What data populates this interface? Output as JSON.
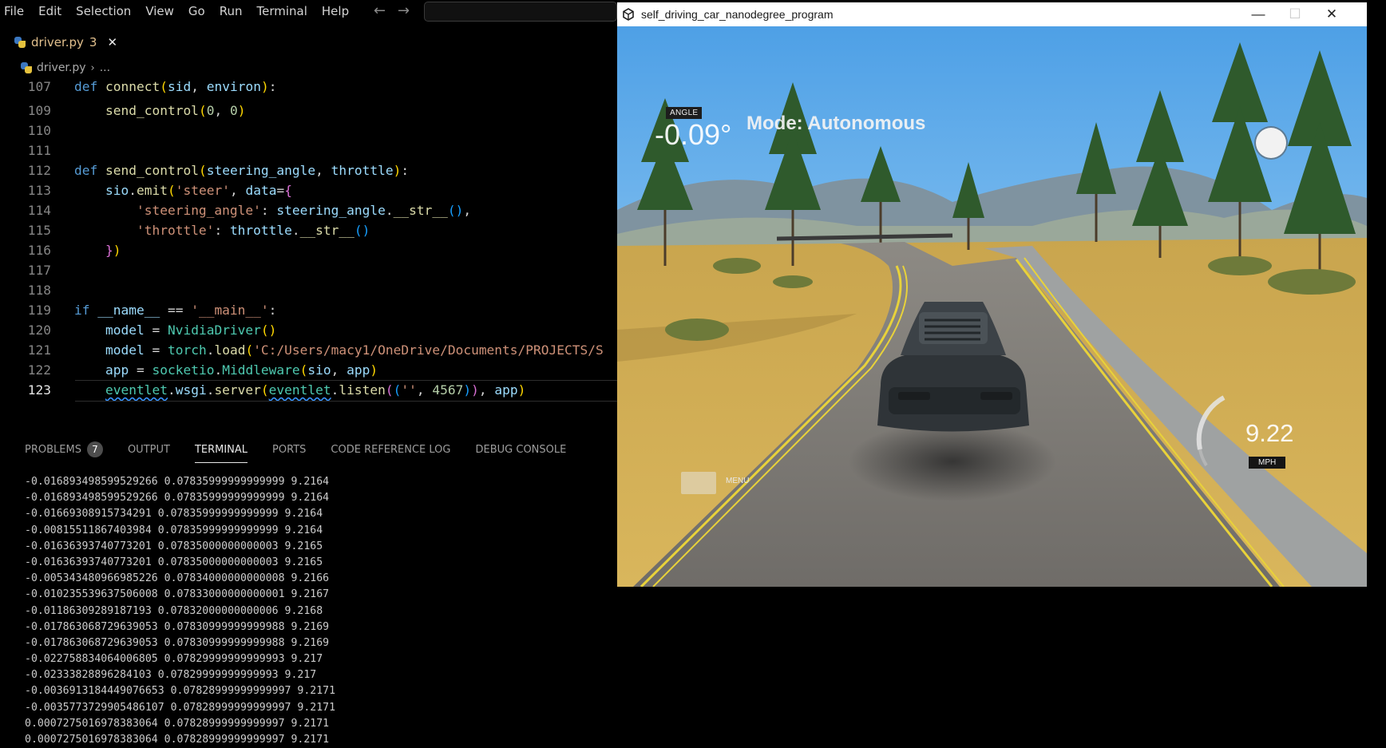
{
  "menubar": {
    "items": [
      "File",
      "Edit",
      "Selection",
      "View",
      "Go",
      "Run",
      "Terminal",
      "Help"
    ]
  },
  "editor_tab": {
    "file": "driver.py",
    "problems": "3"
  },
  "breadcrumb": {
    "file": "driver.py",
    "rest": "..."
  },
  "code": {
    "lines": [
      {
        "n": "107",
        "html": "<span class=\"kw\">def</span> <span class=\"fn\">connect</span><span class=\"br1\">(</span><span class=\"var\">sid</span>, <span class=\"var\">environ</span><span class=\"br1\">)</span>:"
      },
      {
        "n": "109",
        "html": "    <span class=\"fn\">send_control</span><span class=\"br1\">(</span><span class=\"num\">0</span>, <span class=\"num\">0</span><span class=\"br1\">)</span>"
      },
      {
        "n": "110",
        "html": ""
      },
      {
        "n": "111",
        "html": ""
      },
      {
        "n": "112",
        "html": "<span class=\"kw\">def</span> <span class=\"fn\">send_control</span><span class=\"br1\">(</span><span class=\"var\">steering_angle</span>, <span class=\"var\">throttle</span><span class=\"br1\">)</span>:"
      },
      {
        "n": "113",
        "html": "    <span class=\"var\">sio</span>.<span class=\"fn\">emit</span><span class=\"br1\">(</span><span class=\"str\">'steer'</span>, <span class=\"var\">data</span>=<span class=\"br2\">{</span>"
      },
      {
        "n": "114",
        "html": "        <span class=\"str\">'steering_angle'</span>: <span class=\"var\">steering_angle</span>.<span class=\"fn\">__str__</span><span class=\"br3\">()</span>,"
      },
      {
        "n": "115",
        "html": "        <span class=\"str\">'throttle'</span>: <span class=\"var\">throttle</span>.<span class=\"fn\">__str__</span><span class=\"br3\">()</span>"
      },
      {
        "n": "116",
        "html": "    <span class=\"br2\">}</span><span class=\"br1\">)</span>"
      },
      {
        "n": "117",
        "html": ""
      },
      {
        "n": "118",
        "html": ""
      },
      {
        "n": "119",
        "html": "<span class=\"kw\">if</span> <span class=\"var\">__name__</span> == <span class=\"str\">'__main__'</span>:"
      },
      {
        "n": "120",
        "html": "    <span class=\"var\">model</span> = <span class=\"cls\">NvidiaDriver</span><span class=\"br1\">()</span>"
      },
      {
        "n": "121",
        "html": "    <span class=\"var\">model</span> = <span class=\"cls\">torch</span>.<span class=\"fn\">load</span><span class=\"br1\">(</span><span class=\"str\">'C:/Users/macy1/OneDrive/Documents/PROJECTS/S</span>"
      },
      {
        "n": "122",
        "html": "    <span class=\"var\">app</span> = <span class=\"cls\">socketio</span>.<span class=\"cls\">Middleware</span><span class=\"br1\">(</span><span class=\"var\">sio</span>, <span class=\"var\">app</span><span class=\"br1\">)</span>"
      },
      {
        "n": "123",
        "html": "    <span class=\"cls squig\">eventlet</span>.<span class=\"var\">wsgi</span>.<span class=\"fn\">server</span><span class=\"br1\">(</span><span class=\"cls squig\">eventlet</span>.<span class=\"fn\">listen</span><span class=\"br2\">(</span><span class=\"br3\">(</span><span class=\"str\">''</span>, <span class=\"num\">4567</span><span class=\"br3\">)</span><span class=\"br2\">)</span>, <span class=\"var\">app</span><span class=\"br1\">)</span>"
      }
    ]
  },
  "panel": {
    "tabs": [
      {
        "label": "PROBLEMS",
        "badge": "7",
        "active": false
      },
      {
        "label": "OUTPUT",
        "active": false
      },
      {
        "label": "TERMINAL",
        "active": true
      },
      {
        "label": "PORTS",
        "active": false
      },
      {
        "label": "CODE REFERENCE LOG",
        "active": false
      },
      {
        "label": "DEBUG CONSOLE",
        "active": false
      }
    ]
  },
  "terminal": {
    "lines": [
      "-0.016893498599529266 0.07835999999999999 9.2164",
      "-0.016893498599529266 0.07835999999999999 9.2164",
      "-0.01669308915734291 0.07835999999999999 9.2164",
      "-0.00815511867403984 0.07835999999999999 9.2164",
      "-0.01636393740773201 0.07835000000000003 9.2165",
      "-0.01636393740773201 0.07835000000000003 9.2165",
      "-0.005343480966985226 0.07834000000000008 9.2166",
      "-0.010235539637506008 0.07833000000000001 9.2167",
      "-0.01186309289187193 0.07832000000000006 9.2168",
      "-0.017863068729639053 0.07830999999999988 9.2169",
      "-0.017863068729639053 0.07830999999999988 9.2169",
      "-0.022758834064006805 0.07829999999999993 9.217",
      "-0.02333828896284103 0.07829999999999993 9.217",
      "-0.0036913184449076653 0.07828999999999997 9.2171",
      "-0.0035773729905486107 0.07828999999999997 9.2171",
      "0.0007275016978383064 0.07828999999999997 9.2171",
      "0.0007275016978383064 0.07828999999999997 9.2171"
    ]
  },
  "simulator": {
    "title": "self_driving_car_nanodegree_program",
    "angle_label": "ANGLE",
    "angle_value": "-0.09°",
    "mode": "Mode: Autonomous",
    "speed_value": "9.22",
    "speed_unit": "MPH",
    "menu_label": "MENU"
  },
  "colors": {
    "editor_bg": "#000000",
    "accent": "#569cd6",
    "titlebar": "#ffffff"
  }
}
